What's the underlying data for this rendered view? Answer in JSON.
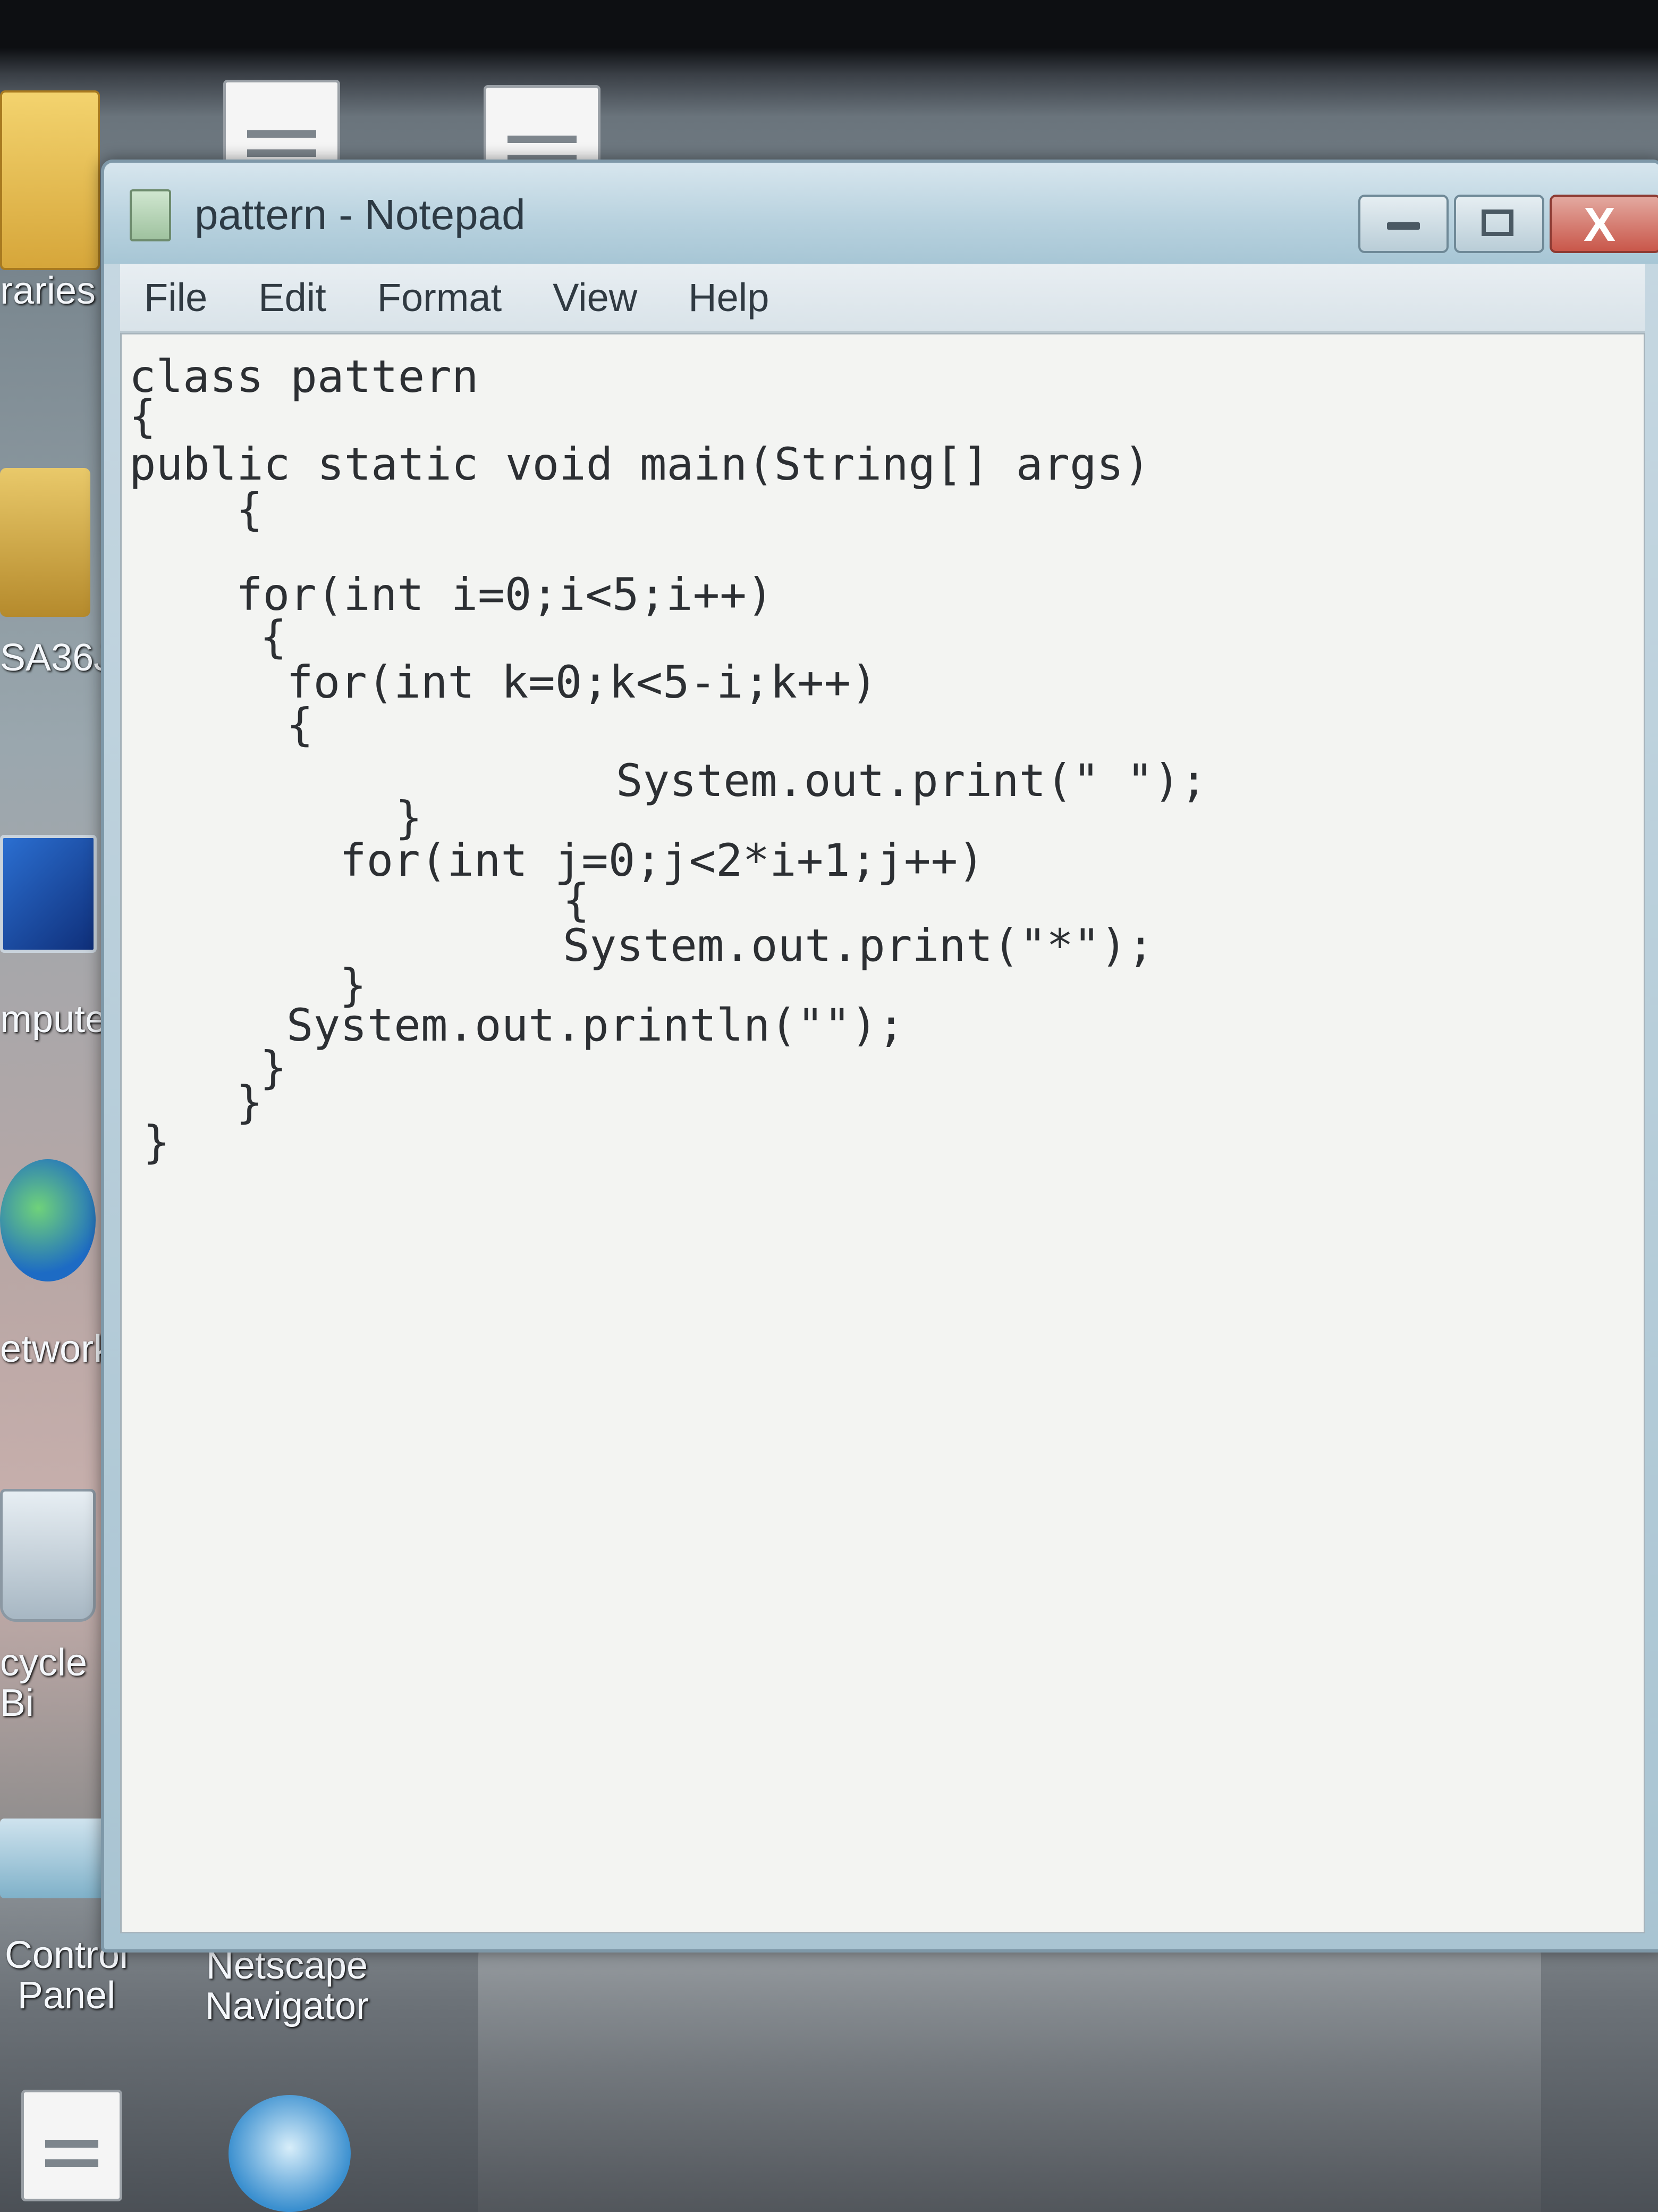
{
  "desktop": {
    "icons": [
      {
        "label": "raries"
      },
      {
        "label": "SA36J"
      },
      {
        "label": "mpute"
      },
      {
        "label": "etwork"
      },
      {
        "label": "cycle Bi"
      },
      {
        "label": "Control\nPanel"
      },
      {
        "label": "Netscape\nNavigator"
      }
    ]
  },
  "window": {
    "title": "pattern - Notepad",
    "buttons": {
      "close_glyph": "X"
    }
  },
  "menu": {
    "items": [
      "File",
      "Edit",
      "Format",
      "View",
      "Help"
    ]
  },
  "editor": {
    "lines": [
      "class pattern",
      "{",
      "public static void main(String[] args)",
      "{",
      "for(int i=0;i<5;i++)",
      "{",
      "for(int k=0;k<5-i;k++)",
      "{",
      "System.out.print(\" \");",
      "}",
      "for(int j=0;j<2*i+1;j++)",
      "{",
      "System.out.print(\"*\");",
      "}",
      "System.out.println(\"\");",
      "}",
      "}",
      "}"
    ]
  }
}
